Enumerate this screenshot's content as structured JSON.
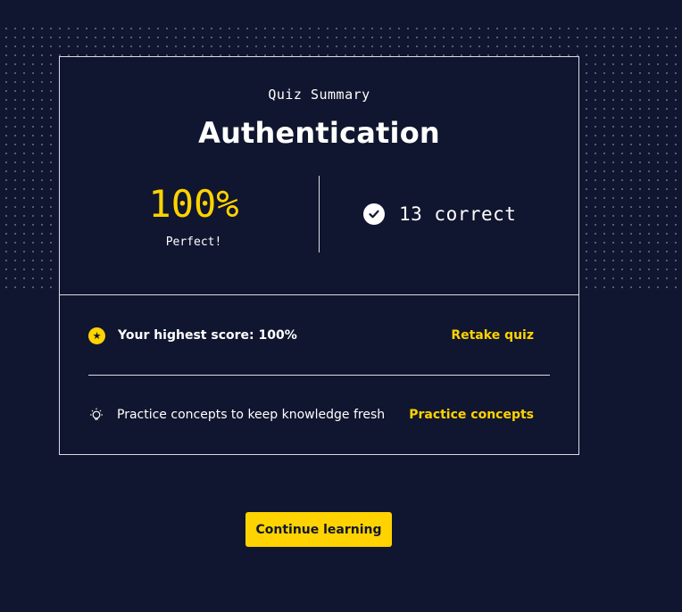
{
  "summary": {
    "subtitle": "Quiz Summary",
    "title": "Authentication",
    "score": "100%",
    "score_label": "Perfect!",
    "correct_text": "13 correct"
  },
  "details": {
    "highest_score_text": "Your highest score: 100%",
    "retake_label": "Retake quiz",
    "practice_text": "Practice concepts to keep knowledge fresh",
    "practice_label": "Practice concepts"
  },
  "actions": {
    "continue_label": "Continue learning"
  },
  "icons": {
    "check": "check-circle-icon",
    "star": "star-circle-icon",
    "lightbulb": "lightbulb-icon"
  },
  "colors": {
    "background": "#10162f",
    "accent": "#ffd300",
    "text": "#ffffff",
    "border": "#d9dce7"
  }
}
